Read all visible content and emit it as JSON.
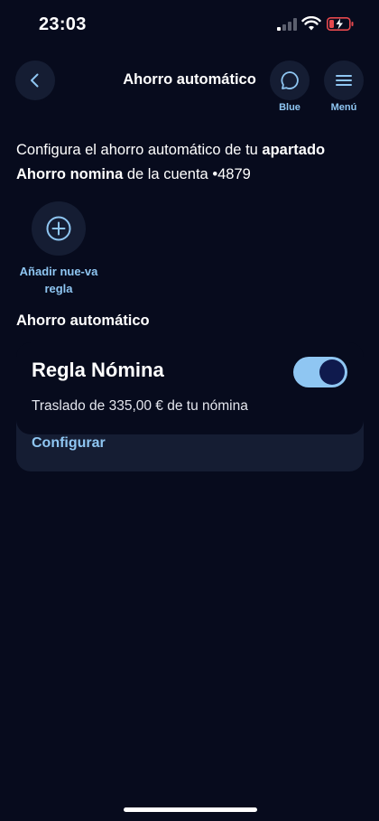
{
  "status_bar": {
    "time": "23:03"
  },
  "header": {
    "title": "Ahorro automático",
    "chat_label": "Blue",
    "menu_label": "Menú"
  },
  "intro": {
    "part1": "Configura el ahorro automático de tu ",
    "bold1": "apartado",
    "space": " ",
    "bold2": "Ahorro nomina",
    "part2": " de la cuenta •4879"
  },
  "add_rule": {
    "label": "Añadir nue-va regla"
  },
  "section": {
    "title": "Ahorro automático"
  },
  "rule": {
    "title": "Regla Nómina",
    "description": "Traslado de 335,00 € de tu nómina",
    "enabled": true,
    "configure_label": "Configurar"
  },
  "colors": {
    "background": "#070b1d",
    "surface": "#151d33",
    "accent": "#8fc6f2",
    "battery_low": "#e5484d"
  },
  "icons": {
    "back": "chevron-left-icon",
    "chat": "chat-bubble-icon",
    "menu": "hamburger-icon",
    "add": "plus-circle-icon"
  }
}
